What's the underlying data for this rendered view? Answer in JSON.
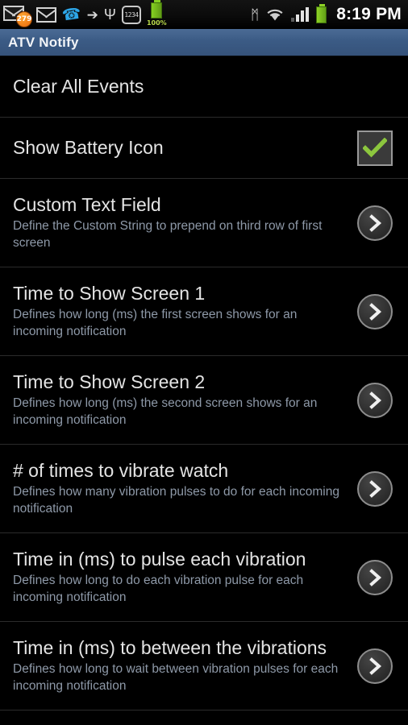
{
  "status_bar": {
    "left_icons": [
      {
        "name": "mail-muted-icon",
        "badge": "279"
      },
      {
        "name": "mail-icon"
      },
      {
        "name": "phone-call-icon",
        "glyph": "✆"
      },
      {
        "name": "flash-icon",
        "glyph": "⚡"
      },
      {
        "name": "usb-icon",
        "glyph": "Ψ"
      },
      {
        "name": "watch-clock-icon",
        "label": "1234"
      },
      {
        "name": "battery-percent-icon",
        "label": "100%"
      }
    ],
    "right_icons": [
      {
        "name": "bluetooth-icon",
        "glyph": "ᛗ"
      },
      {
        "name": "wifi-icon"
      },
      {
        "name": "signal-bars-icon"
      },
      {
        "name": "battery-icon"
      }
    ],
    "clock": "8:19 PM"
  },
  "titlebar": {
    "title": "ATV Notify",
    "color": "#3b5b85"
  },
  "settings": {
    "rows": [
      {
        "title": "Clear All Events",
        "subtitle": "",
        "widget": "none"
      },
      {
        "title": "Show Battery Icon",
        "subtitle": "",
        "widget": "checkbox",
        "checked": true
      },
      {
        "title": "Custom Text Field",
        "subtitle": "Define the Custom String to prepend on third row of first screen",
        "widget": "chevron"
      },
      {
        "title": "Time to Show Screen 1",
        "subtitle": "Defines how long (ms) the first screen shows for an incoming notification",
        "widget": "chevron"
      },
      {
        "title": "Time to Show Screen 2",
        "subtitle": "Defines how long (ms) the second screen shows for an incoming notification",
        "widget": "chevron"
      },
      {
        "title": "# of times to vibrate watch",
        "subtitle": "Defines how many vibration pulses to do for each incoming notification",
        "widget": "chevron"
      },
      {
        "title": "Time in (ms) to pulse each vibration",
        "subtitle": "Defines how long to do each vibration pulse for each incoming notification",
        "widget": "chevron"
      },
      {
        "title": "Time in (ms) to between the vibrations",
        "subtitle": "Defines how long to wait between vibration pulses for each incoming notification",
        "widget": "chevron"
      }
    ],
    "colors": {
      "title_text": "#e4e4e4",
      "subtitle_text": "#8e99a8",
      "divider": "#2b2b2b",
      "checkbox_check": "#8cc63e",
      "background": "#000000"
    }
  }
}
